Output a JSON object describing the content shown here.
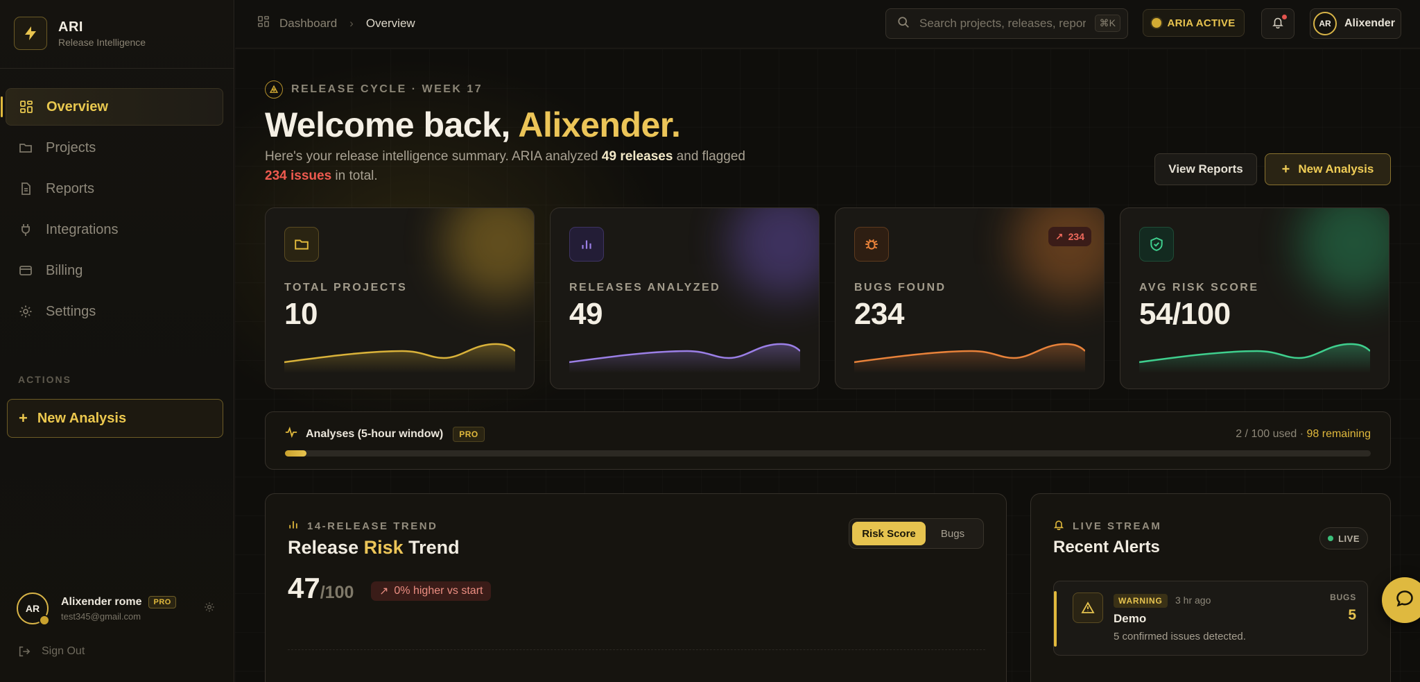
{
  "brand": {
    "name": "ARI",
    "subtitle": "Release Intelligence"
  },
  "sidebar": {
    "items": [
      {
        "label": "Overview",
        "icon": "grid-icon",
        "active": true
      },
      {
        "label": "Projects",
        "icon": "folder-icon",
        "active": false
      },
      {
        "label": "Reports",
        "icon": "file-icon",
        "active": false
      },
      {
        "label": "Integrations",
        "icon": "plug-icon",
        "active": false
      },
      {
        "label": "Billing",
        "icon": "card-icon",
        "active": false
      },
      {
        "label": "Settings",
        "icon": "gear-icon",
        "active": false
      }
    ],
    "actions_label": "ACTIONS",
    "new_analysis": "New Analysis",
    "user": {
      "initials": "AR",
      "name": "Alixender rome",
      "plan": "PRO",
      "email": "test345@gmail.com"
    },
    "sign_out": "Sign Out"
  },
  "topbar": {
    "breadcrumb": [
      "Dashboard",
      "Overview"
    ],
    "search_placeholder": "Search projects, releases, reports...",
    "search_shortcut": "⌘K",
    "status": "ARIA ACTIVE",
    "user": {
      "initials": "AR",
      "name": "Alixender"
    }
  },
  "hero": {
    "eyebrow": "RELEASE CYCLE · WEEK 17",
    "welcome_prefix": "Welcome back, ",
    "welcome_name": "Alixender.",
    "summary_1": "Here's your release intelligence summary. ARIA analyzed ",
    "summary_releases": "49 releases",
    "summary_2": " and flagged ",
    "summary_issues": "234 issues",
    "summary_3": " in total.",
    "view_reports": "View Reports",
    "new_analysis": "New Analysis"
  },
  "stats": [
    {
      "label": "TOTAL PROJECTS",
      "value": "10",
      "icon": "folder-icon",
      "color": "#d9b23a"
    },
    {
      "label": "RELEASES ANALYZED",
      "value": "49",
      "icon": "bar-chart-icon",
      "color": "#9b7fe6"
    },
    {
      "label": "BUGS FOUND",
      "value": "234",
      "icon": "bug-icon",
      "color": "#e8823a",
      "badge": "234"
    },
    {
      "label": "AVG RISK SCORE",
      "value": "54/100",
      "icon": "shield-check-icon",
      "color": "#3fcf8e"
    }
  ],
  "usage": {
    "title": "Analyses (5-hour window)",
    "plan": "PRO",
    "used_text": "2 / 100 used · ",
    "remaining_text": "98 remaining",
    "used": 2,
    "limit": 100
  },
  "trend": {
    "eyebrow": "14-RELEASE TREND",
    "title_plain": "Release ",
    "title_accent": "Risk",
    "title_end": " Trend",
    "value": "47",
    "of": "/100",
    "change": "0% higher vs start",
    "toggle": [
      "Risk Score",
      "Bugs"
    ]
  },
  "alerts": {
    "eyebrow": "LIVE STREAM",
    "title": "Recent Alerts",
    "live": "LIVE",
    "items": [
      {
        "severity": "WARNING",
        "time": "3 hr ago",
        "name": "Demo",
        "desc": "5 confirmed issues detected.",
        "bugs_label": "BUGS",
        "bugs": "5"
      }
    ]
  }
}
